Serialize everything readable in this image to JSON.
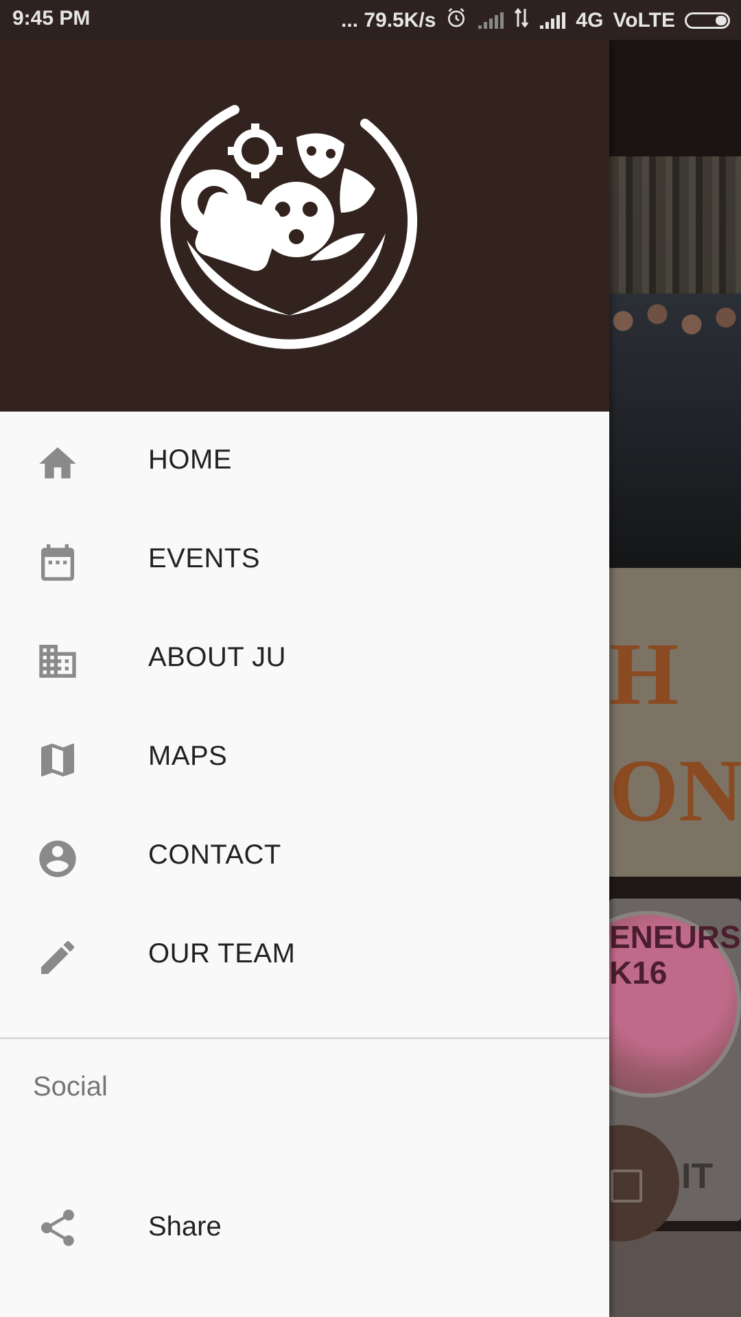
{
  "status_bar": {
    "time": "9:45 PM",
    "net_speed": "... 79.5K/s",
    "network": "4G",
    "volte": "VoLTE"
  },
  "drawer": {
    "menu": [
      {
        "label": "HOME",
        "icon": "home-icon"
      },
      {
        "label": "EVENTS",
        "icon": "calendar-icon"
      },
      {
        "label": "ABOUT JU",
        "icon": "building-icon"
      },
      {
        "label": "MAPS",
        "icon": "map-icon"
      },
      {
        "label": "CONTACT",
        "icon": "account-circle-icon"
      },
      {
        "label": "OUR TEAM",
        "icon": "pencil-icon"
      }
    ],
    "section_title": "Social",
    "share_label": "Share"
  },
  "background": {
    "card_title_partial": "H ON",
    "card_banner_partial": "ENEURS K16",
    "card_footer_partial": "IT"
  },
  "colors": {
    "drawer_header": "#33231f",
    "drawer_bg": "#f9f9f9",
    "icon_gray": "#8a8a8a",
    "text_primary": "#212121",
    "text_secondary": "#757575"
  }
}
